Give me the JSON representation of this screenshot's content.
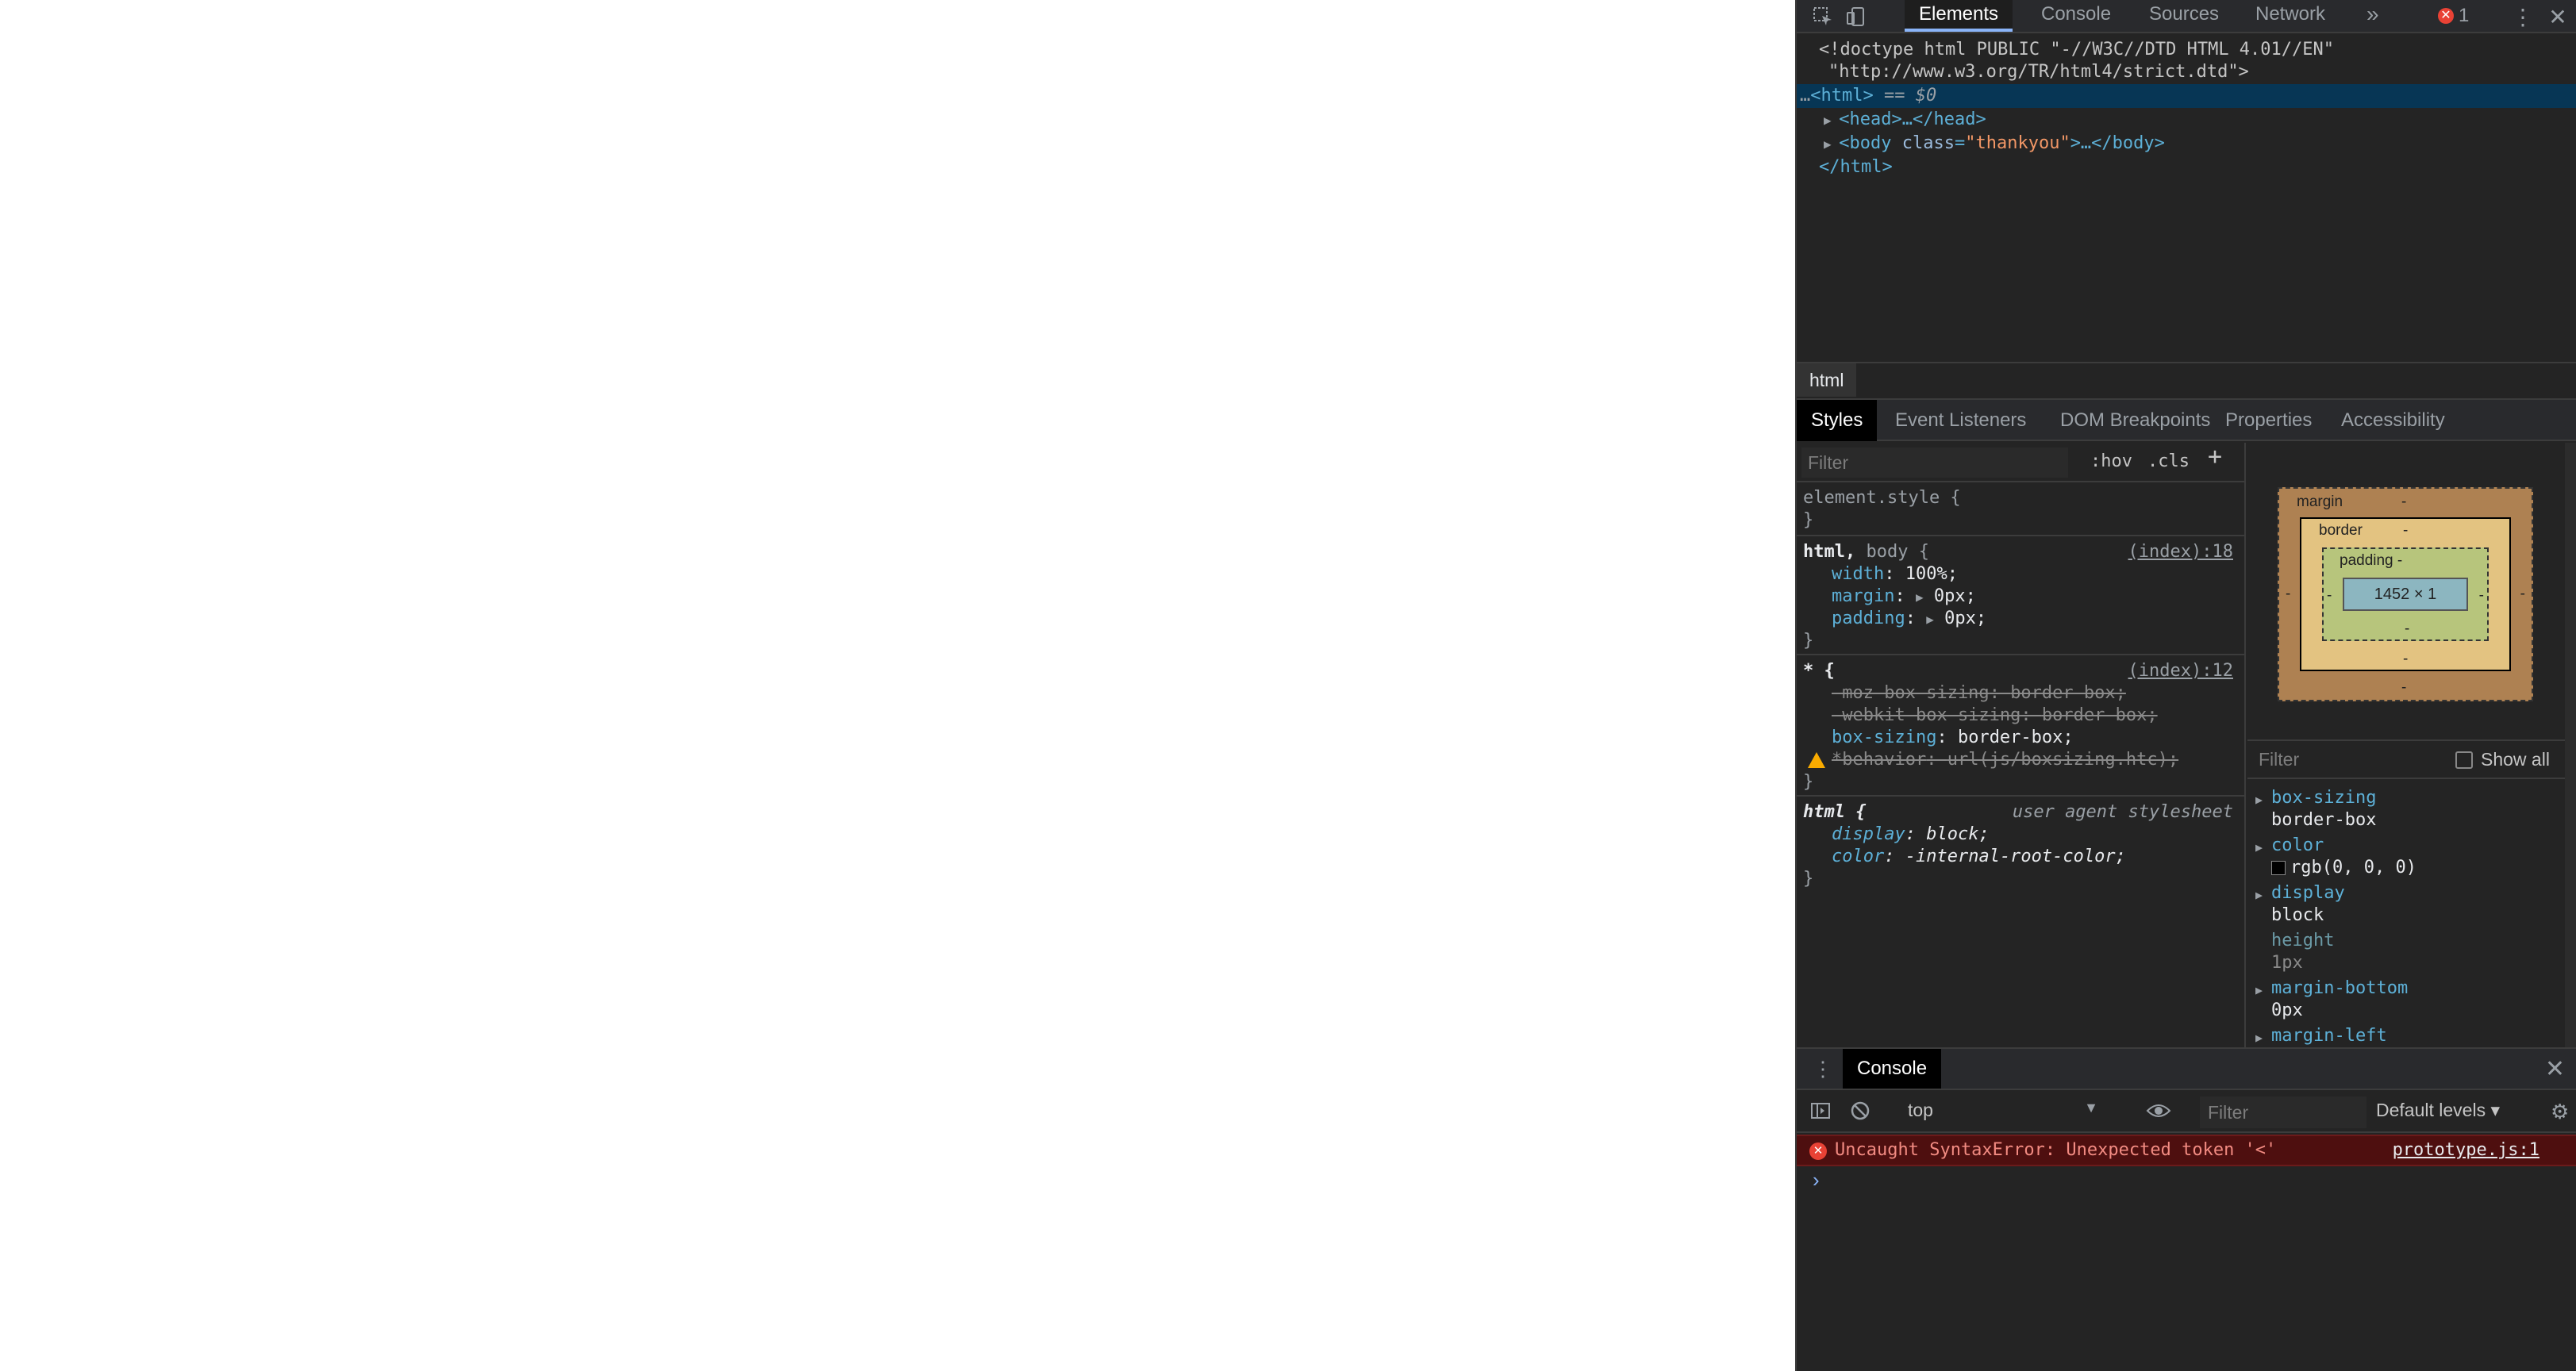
{
  "toolbar": {
    "tabs": [
      "Elements",
      "Console",
      "Sources",
      "Network"
    ],
    "more": "»",
    "error_count": "1"
  },
  "dom": {
    "doctype_1": "<!doctype html PUBLIC \"-//W3C//DTD HTML 4.01//EN\"",
    "doctype_2": "\"http://www.w3.org/TR/html4/strict.dtd\">",
    "html_open_prefix": "…",
    "html_open": "<html>",
    "html_open_suffix": " == $0",
    "head": "<head>…</head>",
    "body_tag": "<body ",
    "body_attr_name": "class",
    "body_attr_val": "\"thankyou\"",
    "body_close": ">…</body>",
    "html_close": "</html>"
  },
  "breadcrumb": "html",
  "subtabs": [
    "Styles",
    "Event Listeners",
    "DOM Breakpoints",
    "Properties",
    "Accessibility"
  ],
  "styles": {
    "filter_placeholder": "Filter",
    "hov": ":hov",
    "cls": ".cls",
    "plus": "+",
    "element_style": "element.style {",
    "close_brace": "}",
    "rule1": {
      "selector_bold": "html,",
      "selector_gray": " body {",
      "source": "(index):18",
      "props": [
        {
          "name": "width",
          "value": "100%;"
        },
        {
          "name": "margin",
          "value": "0px;"
        },
        {
          "name": "padding",
          "value": "0px;"
        }
      ]
    },
    "rule2": {
      "selector": "* {",
      "source": "(index):12",
      "props": [
        {
          "name": "-moz-box-sizing",
          "value": "border-box;"
        },
        {
          "name": "-webkit-box-sizing",
          "value": "border-box;"
        },
        {
          "name": "box-sizing",
          "value": "border-box;"
        },
        {
          "name": "*behavior",
          "value": "url(js/boxsizing.htc);"
        }
      ]
    },
    "rule3": {
      "selector": "html {",
      "source": "user agent stylesheet",
      "props": [
        {
          "name": "display",
          "value": "block;"
        },
        {
          "name": "color",
          "value": "-internal-root-color;"
        }
      ]
    }
  },
  "boxmodel": {
    "margin_label": "margin",
    "border_label": "border",
    "padding_label": "padding -",
    "dash": "-",
    "content": "1452 × 1"
  },
  "computed": {
    "filter_placeholder": "Filter",
    "show_all": "Show all",
    "props": [
      {
        "name": "box-sizing",
        "value": "border-box"
      },
      {
        "name": "color",
        "value": "rgb(0, 0, 0)"
      },
      {
        "name": "display",
        "value": "block"
      },
      {
        "name": "height",
        "value": "1px"
      },
      {
        "name": "margin-bottom",
        "value": "0px"
      },
      {
        "name": "margin-left",
        "value": ""
      }
    ]
  },
  "drawer": {
    "tab": "Console",
    "context": "top",
    "filter_placeholder": "Filter",
    "levels": "Default levels ▾",
    "error_message": "Uncaught SyntaxError: Unexpected token '<'",
    "error_source": "prototype.js:1",
    "prompt": "›"
  },
  "colors": {
    "panel_bg": "#242424",
    "selected_row": "#073655",
    "tag": "#5db0d7",
    "attr_value": "#f29766",
    "error_bg": "#4e0f0f",
    "error_text": "#f28b82"
  }
}
